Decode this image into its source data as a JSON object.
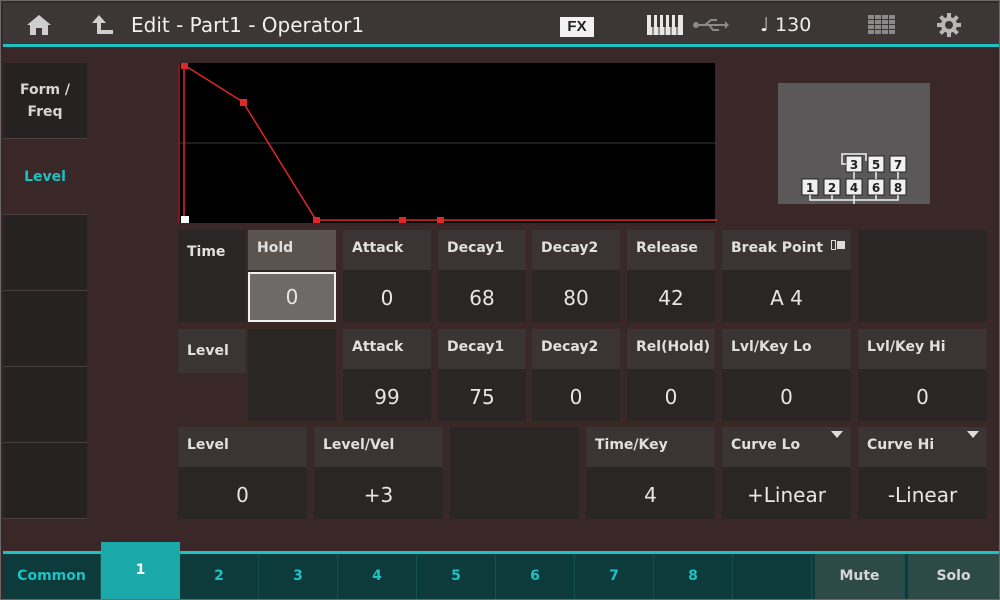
{
  "header": {
    "title": "Edit - Part1 - Operator1",
    "fx_label": "FX",
    "tempo": "130"
  },
  "left_tabs": [
    {
      "label": "Form /\nFreq",
      "selected": false
    },
    {
      "label": "Level",
      "selected": true
    },
    {
      "label": "",
      "selected": false
    },
    {
      "label": "",
      "selected": false
    },
    {
      "label": "",
      "selected": false
    },
    {
      "label": "",
      "selected": false
    }
  ],
  "algorithm": {
    "top_row": [
      "3",
      "5",
      "7"
    ],
    "bottom_row": [
      "1",
      "2",
      "4",
      "6",
      "8"
    ]
  },
  "time_row": {
    "label": "Time",
    "hold": {
      "label": "Hold",
      "value": "0"
    },
    "attack": {
      "label": "Attack",
      "value": "0"
    },
    "decay1": {
      "label": "Decay1",
      "value": "68"
    },
    "decay2": {
      "label": "Decay2",
      "value": "80"
    },
    "release": {
      "label": "Release",
      "value": "42"
    },
    "break_point": {
      "label": "Break Point",
      "value": "A 4"
    }
  },
  "level_row": {
    "label": "Level",
    "attack": {
      "label": "Attack",
      "value": "99"
    },
    "decay1": {
      "label": "Decay1",
      "value": "75"
    },
    "decay2": {
      "label": "Decay2",
      "value": "0"
    },
    "rel_hold": {
      "label": "Rel(Hold)",
      "value": "0"
    },
    "lvl_key_lo": {
      "label": "Lvl/Key Lo",
      "value": "0"
    },
    "lvl_key_hi": {
      "label": "Lvl/Key Hi",
      "value": "0"
    }
  },
  "bottom_row": {
    "level": {
      "label": "Level",
      "value": "0"
    },
    "level_vel": {
      "label": "Level/Vel",
      "value": "+3"
    },
    "time_key": {
      "label": "Time/Key",
      "value": "4"
    },
    "curve_lo": {
      "label": "Curve Lo",
      "value": "+Linear"
    },
    "curve_hi": {
      "label": "Curve Hi",
      "value": "-Linear"
    }
  },
  "bottom_tabs": {
    "common": "Common",
    "operators": [
      "1",
      "2",
      "3",
      "4",
      "5",
      "6",
      "7",
      "8"
    ],
    "mute": "Mute",
    "solo": "Solo"
  },
  "colors": {
    "accent": "#1ec2c2",
    "envelope": "#e0282b",
    "selected_cell": "#6e6a68"
  }
}
